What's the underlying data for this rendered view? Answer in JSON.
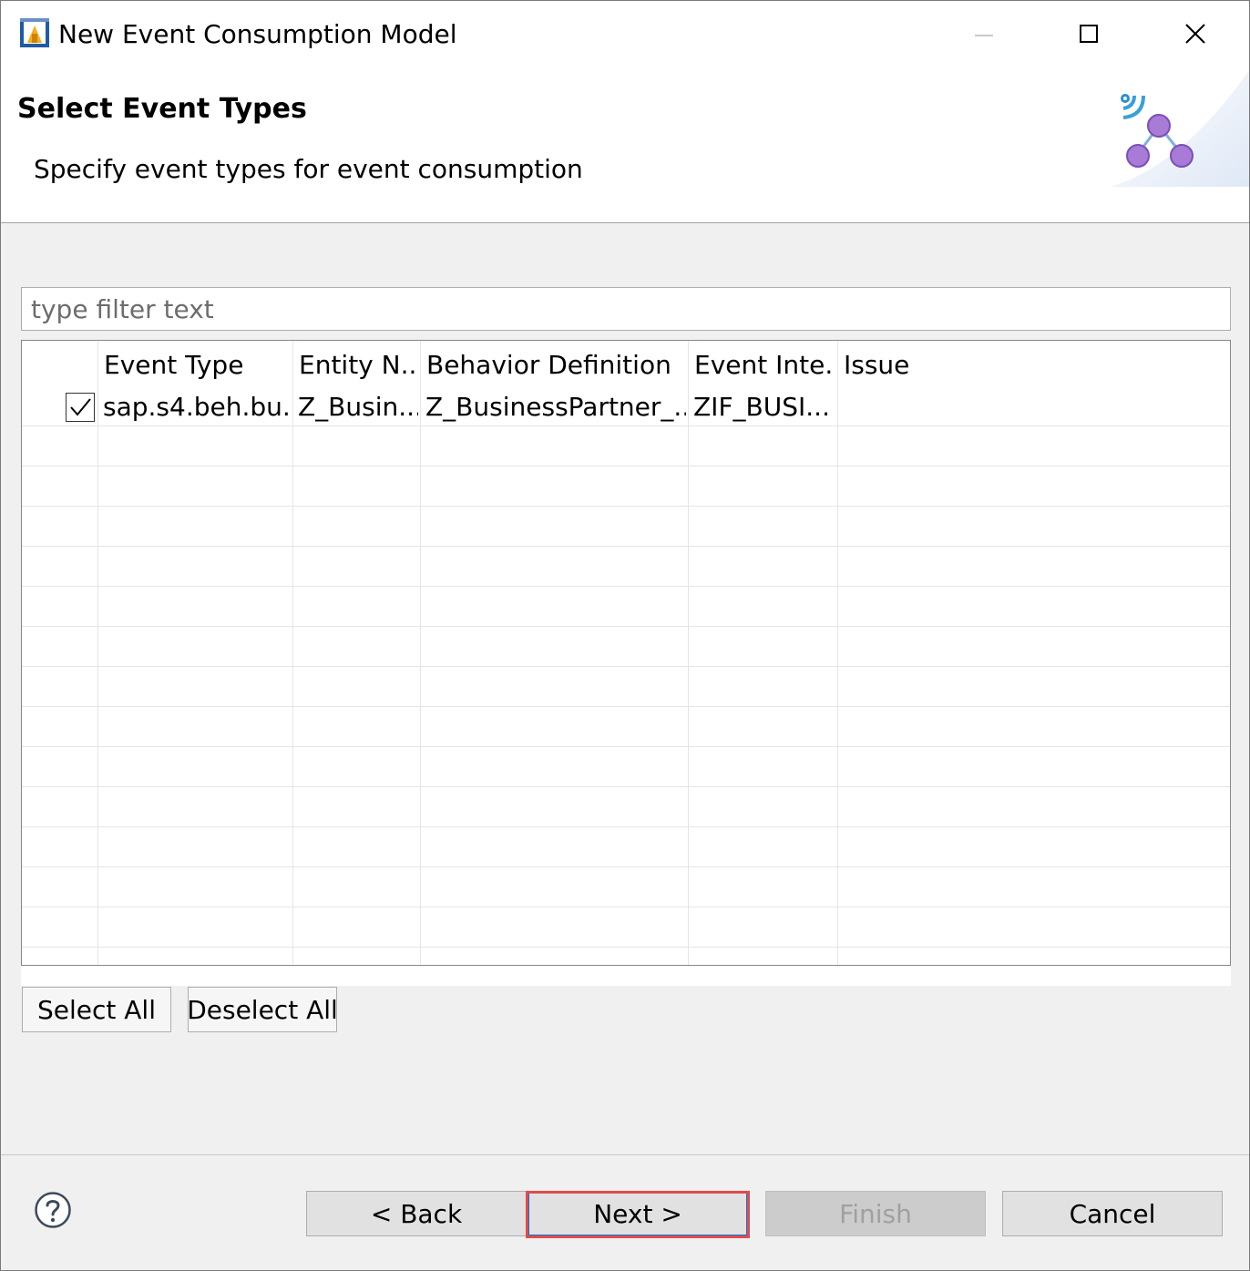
{
  "window": {
    "title": "New Event Consumption Model",
    "icon": "eclipse-wizard-icon"
  },
  "header": {
    "title": "Select Event Types",
    "description": "Specify event types for event consumption",
    "image": "event-network-icon"
  },
  "filter": {
    "placeholder": "type filter text",
    "value": ""
  },
  "table": {
    "columns": [
      "Event Type",
      "Entity N...",
      "Behavior Definition",
      "Event Inte...",
      "Issue"
    ],
    "rows": [
      {
        "checked": true,
        "event_type": "sap.s4.beh.bu...",
        "entity_name": "Z_Busin...",
        "behavior_definition": "Z_BusinessPartner_...",
        "event_interface": "ZIF_BUSI...",
        "issue": ""
      }
    ]
  },
  "selection_buttons": {
    "select_all": "Select All",
    "deselect_all": "Deselect All"
  },
  "footer": {
    "help_icon": "question-mark-icon",
    "back": "< Back",
    "next": "Next >",
    "finish": "Finish",
    "cancel": "Cancel"
  }
}
